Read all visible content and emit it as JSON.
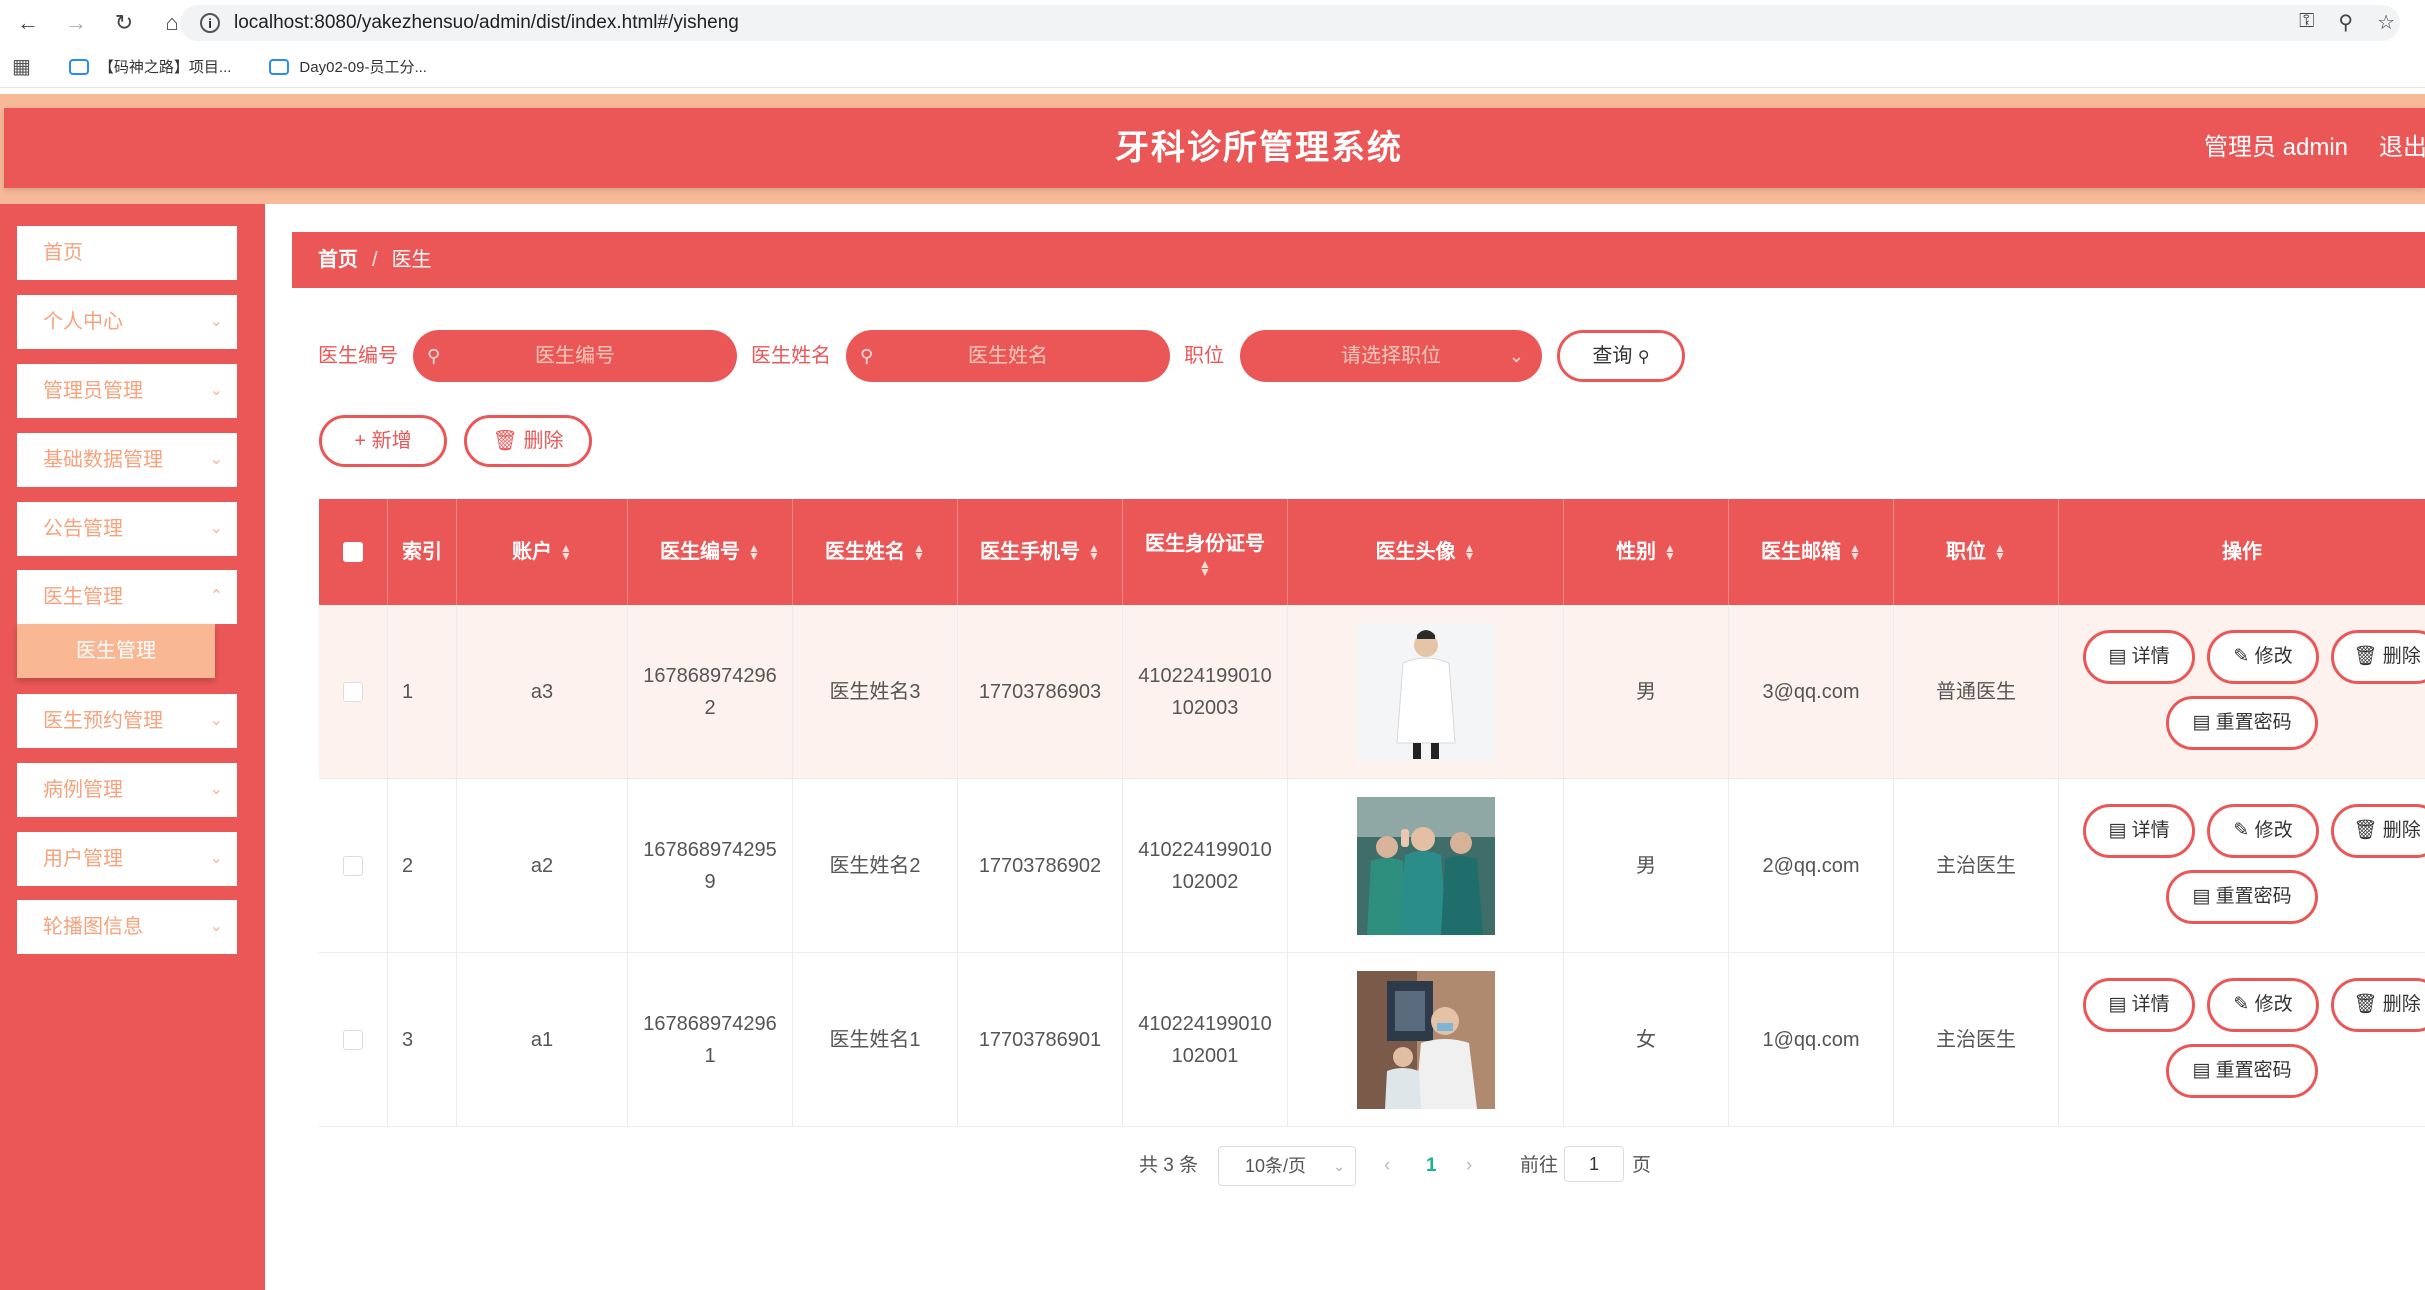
{
  "browser": {
    "url": "localhost:8080/yakezhensuo/admin/dist/index.html#/yisheng",
    "bookmarks": [
      "【码神之路】项目...",
      "Day02-09-员工分..."
    ]
  },
  "header": {
    "title": "牙科诊所管理系统",
    "admin": "管理员 admin",
    "logout": "退出登录"
  },
  "sidebar": {
    "items": [
      {
        "label": "首页",
        "has_chevron": false
      },
      {
        "label": "个人中心",
        "has_chevron": true
      },
      {
        "label": "管理员管理",
        "has_chevron": true
      },
      {
        "label": "基础数据管理",
        "has_chevron": true
      },
      {
        "label": "公告管理",
        "has_chevron": true
      },
      {
        "label": "医生管理",
        "has_chevron": true
      },
      {
        "label": "医生预约管理",
        "has_chevron": true
      },
      {
        "label": "病例管理",
        "has_chevron": true
      },
      {
        "label": "用户管理",
        "has_chevron": true
      },
      {
        "label": "轮播图信息",
        "has_chevron": true
      }
    ],
    "active_sub": "医生管理"
  },
  "breadcrumb": {
    "home": "首页",
    "separator": "/",
    "current": "医生"
  },
  "search": {
    "label_code": "医生编号",
    "placeholder_code": "医生编号",
    "label_name": "医生姓名",
    "placeholder_name": "医生姓名",
    "label_position": "职位",
    "placeholder_position": "请选择职位",
    "query": "查询"
  },
  "actions": {
    "add": "新增",
    "delete": "删除"
  },
  "table": {
    "headers": {
      "index": "索引",
      "account": "账户",
      "code": "医生编号",
      "name": "医生姓名",
      "phone": "医生手机号",
      "id_card": "医生身份证号",
      "avatar": "医生头像",
      "gender": "性别",
      "email": "医生邮箱",
      "position": "职位",
      "ops": "操作"
    },
    "rows": [
      {
        "index": "1",
        "account": "a3",
        "code1": "167868974296",
        "code2": "2",
        "name": "医生姓名3",
        "phone": "17703786903",
        "id1": "410224199010",
        "id2": "102003",
        "gender": "男",
        "email": "3@qq.com",
        "position": "普通医生"
      },
      {
        "index": "2",
        "account": "a2",
        "code1": "167868974295",
        "code2": "9",
        "name": "医生姓名2",
        "phone": "17703786902",
        "id1": "410224199010",
        "id2": "102002",
        "gender": "男",
        "email": "2@qq.com",
        "position": "主治医生"
      },
      {
        "index": "3",
        "account": "a1",
        "code1": "167868974296",
        "code2": "1",
        "name": "医生姓名1",
        "phone": "17703786901",
        "id1": "410224199010",
        "id2": "102001",
        "gender": "女",
        "email": "1@qq.com",
        "position": "主治医生"
      }
    ],
    "op_labels": {
      "detail": "详情",
      "edit": "修改",
      "delete": "删除",
      "reset": "重置密码"
    }
  },
  "pagination": {
    "total": "共 3 条",
    "page_size": "10条/页",
    "current_page": "1",
    "goto_prefix": "前往",
    "goto_value": "1",
    "goto_suffix": "页"
  },
  "colors": {
    "primary": "#eb5757",
    "accent": "#f7b997",
    "menu_text": "#f7a27c",
    "row_highlight": "#fdf2ee",
    "page_active": "#19b394"
  }
}
